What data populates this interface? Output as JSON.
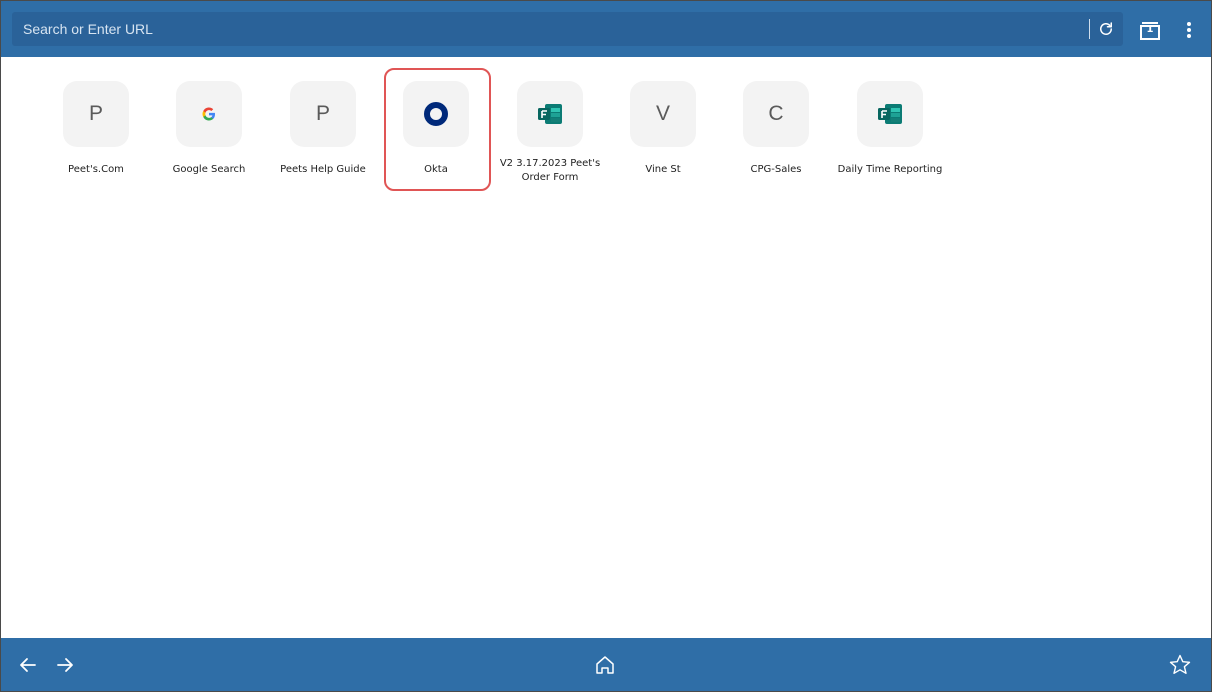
{
  "browser": {
    "url_placeholder": "Search or Enter URL",
    "tab_count": "1",
    "accent_color": "#2f6ea7"
  },
  "icons": {
    "reload": "reload-icon",
    "tabs": "tabs-icon",
    "menu": "kebab-menu-icon",
    "back": "arrow-left-icon",
    "forward": "arrow-right-icon",
    "home": "home-icon",
    "bookmark": "star-icon"
  },
  "shortcuts": [
    {
      "label": "Peet's.Com",
      "initial": "P",
      "icon": "letter"
    },
    {
      "label": "Google Search",
      "initial": "G",
      "icon": "google-icon"
    },
    {
      "label": "Peets Help Guide",
      "initial": "P",
      "icon": "letter"
    },
    {
      "label": "Okta",
      "initial": "",
      "icon": "okta-icon"
    },
    {
      "label": "V2 3.17.2023 Peet's Order Form",
      "initial": "",
      "icon": "forms-icon"
    },
    {
      "label": "Vine St",
      "initial": "V",
      "icon": "letter"
    },
    {
      "label": "CPG-Sales",
      "initial": "C",
      "icon": "letter"
    },
    {
      "label": "Daily Time Reporting",
      "initial": "",
      "icon": "forms-icon"
    }
  ],
  "highlighted_shortcut": "Okta"
}
